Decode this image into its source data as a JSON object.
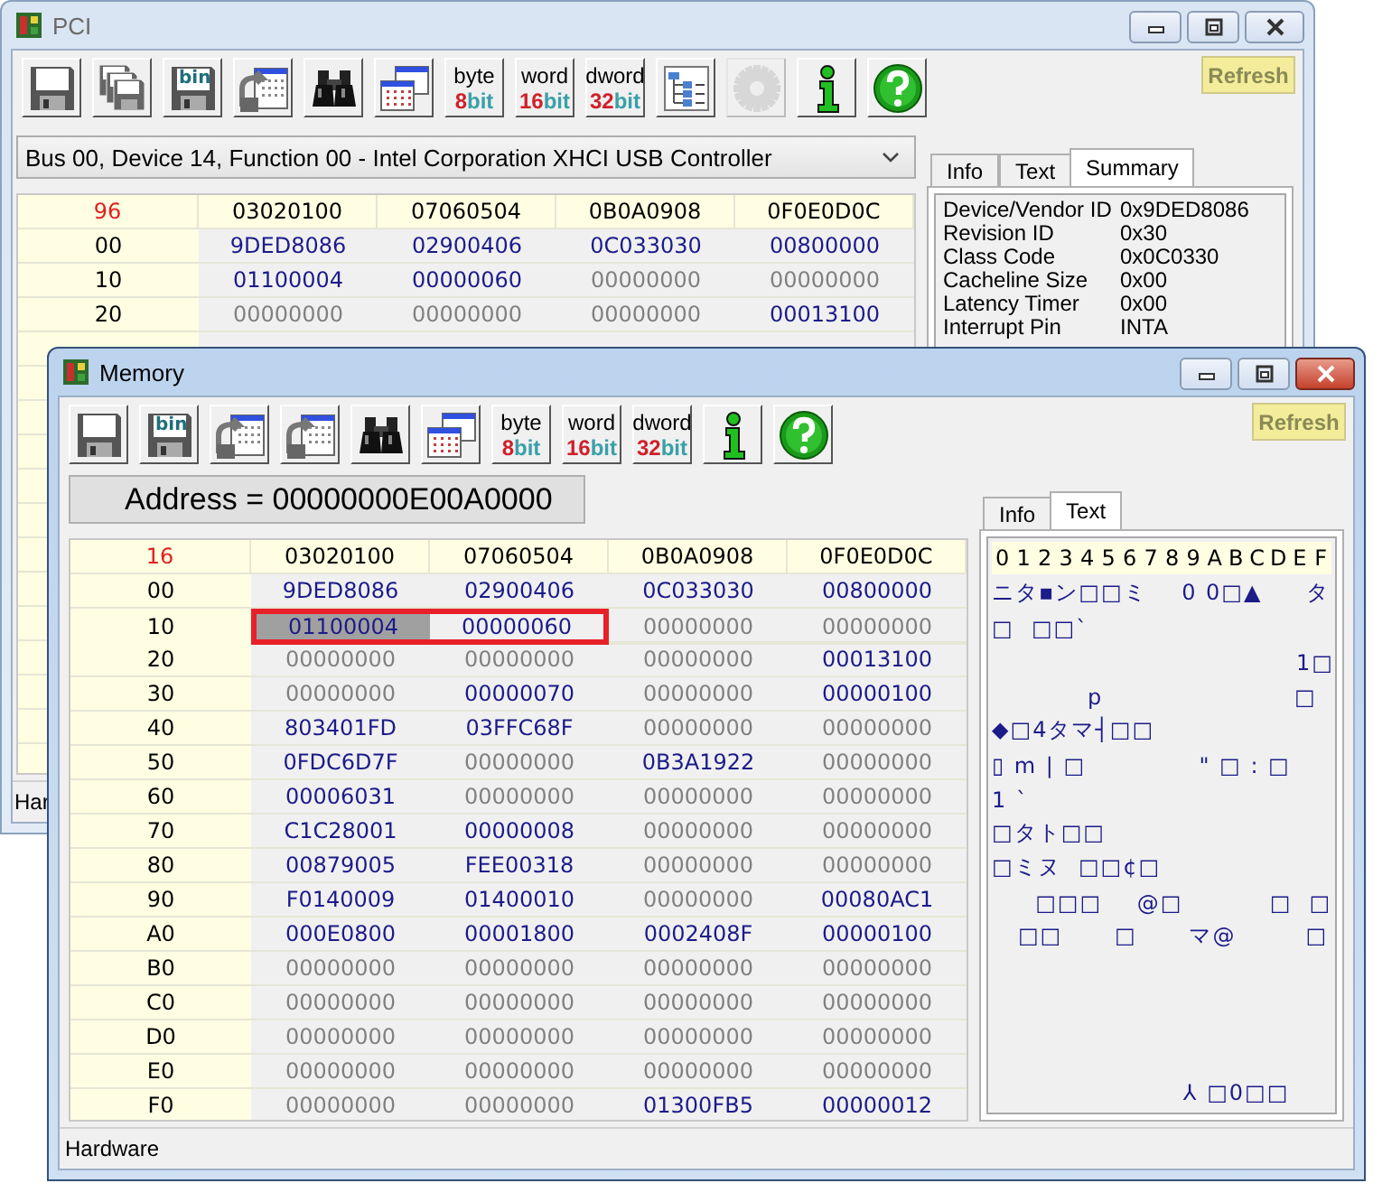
{
  "windows": [
    {
      "title": "PCI",
      "active": false,
      "toolbar": [
        {
          "kind": "floppy",
          "disabled": false
        },
        {
          "kind": "floppies",
          "disabled": false
        },
        {
          "kind": "bin",
          "label": "bin",
          "disabled": false
        },
        {
          "kind": "import",
          "disabled": false
        },
        {
          "kind": "binoculars",
          "disabled": false
        },
        {
          "kind": "windows",
          "disabled": false
        },
        {
          "kind": "width",
          "top": "byte",
          "num": "8",
          "unit": "bit",
          "disabled": false
        },
        {
          "kind": "width",
          "top": "word",
          "num": "16",
          "unit": "bit",
          "disabled": false
        },
        {
          "kind": "width",
          "top": "dword",
          "num": "32",
          "unit": "bit",
          "disabled": false
        },
        {
          "kind": "tree",
          "disabled": false
        },
        {
          "kind": "gear",
          "disabled": true
        },
        {
          "kind": "info",
          "disabled": false
        },
        {
          "kind": "help",
          "disabled": false
        }
      ],
      "refresh": "Refresh",
      "selector": {
        "kind": "dropdown",
        "text": "Bus 00, Device 14, Function 00 - Intel Corporation XHCI USB Controller"
      },
      "table": {
        "corner": "96",
        "columns": [
          "03020100",
          "07060504",
          "0B0A0908",
          "0F0E0D0C"
        ],
        "rows": [
          {
            "addr": "00",
            "marked": false,
            "cells": [
              {
                "v": "9DED8086",
                "dim": false,
                "selected": false
              },
              {
                "v": "02900406",
                "dim": false,
                "selected": false
              },
              {
                "v": "0C033030",
                "dim": false,
                "selected": false
              },
              {
                "v": "00800000",
                "dim": false,
                "selected": false
              }
            ]
          },
          {
            "addr": "10",
            "marked": false,
            "cells": [
              {
                "v": "01100004",
                "dim": false,
                "selected": false
              },
              {
                "v": "00000060",
                "dim": false,
                "selected": false
              },
              {
                "v": "00000000",
                "dim": true,
                "selected": false
              },
              {
                "v": "00000000",
                "dim": true,
                "selected": false
              }
            ]
          },
          {
            "addr": "20",
            "marked": false,
            "cells": [
              {
                "v": "00000000",
                "dim": true,
                "selected": false
              },
              {
                "v": "00000000",
                "dim": true,
                "selected": false
              },
              {
                "v": "00000000",
                "dim": true,
                "selected": false
              },
              {
                "v": "00013100",
                "dim": false,
                "selected": false
              }
            ]
          }
        ]
      },
      "tabs": [
        {
          "label": "Info",
          "selected": false
        },
        {
          "label": "Text",
          "selected": false
        },
        {
          "label": "Summary",
          "selected": true
        }
      ],
      "summary": [
        {
          "label": "Device/Vendor ID",
          "value": "0x9DED8086"
        },
        {
          "label": "Revision ID",
          "value": "0x30"
        },
        {
          "label": "Class Code",
          "value": "0x0C0330"
        },
        {
          "label": "Cacheline Size",
          "value": "0x00"
        },
        {
          "label": "Latency Timer",
          "value": "0x00"
        },
        {
          "label": "Interrupt Pin",
          "value": "INTA"
        }
      ],
      "status": "Har"
    },
    {
      "title": "Memory",
      "active": true,
      "toolbar": [
        {
          "kind": "floppy",
          "disabled": false
        },
        {
          "kind": "bin",
          "label": "bin",
          "disabled": false
        },
        {
          "kind": "import",
          "disabled": false
        },
        {
          "kind": "import",
          "disabled": false
        },
        {
          "kind": "binoculars",
          "disabled": false
        },
        {
          "kind": "windows",
          "disabled": false
        },
        {
          "kind": "width",
          "top": "byte",
          "num": "8",
          "unit": "bit",
          "disabled": false
        },
        {
          "kind": "width",
          "top": "word",
          "num": "16",
          "unit": "bit",
          "disabled": false
        },
        {
          "kind": "width",
          "top": "dword",
          "num": "32",
          "unit": "bit",
          "disabled": false
        },
        {
          "kind": "info",
          "disabled": false
        },
        {
          "kind": "help",
          "disabled": false
        }
      ],
      "refresh": "Refresh",
      "selector": {
        "kind": "address",
        "text": "Address = 00000000E00A0000"
      },
      "table": {
        "corner": "16",
        "columns": [
          "03020100",
          "07060504",
          "0B0A0908",
          "0F0E0D0C"
        ],
        "rows": [
          {
            "addr": "00",
            "marked": false,
            "cells": [
              {
                "v": "9DED8086",
                "dim": false,
                "selected": false
              },
              {
                "v": "02900406",
                "dim": false,
                "selected": false
              },
              {
                "v": "0C033030",
                "dim": false,
                "selected": false
              },
              {
                "v": "00800000",
                "dim": false,
                "selected": false
              }
            ]
          },
          {
            "addr": "10",
            "marked": true,
            "cells": [
              {
                "v": "01100004",
                "dim": false,
                "selected": true
              },
              {
                "v": "00000060",
                "dim": false,
                "selected": false
              },
              {
                "v": "00000000",
                "dim": true,
                "selected": false
              },
              {
                "v": "00000000",
                "dim": true,
                "selected": false
              }
            ]
          },
          {
            "addr": "20",
            "marked": false,
            "cells": [
              {
                "v": "00000000",
                "dim": true,
                "selected": false
              },
              {
                "v": "00000000",
                "dim": true,
                "selected": false
              },
              {
                "v": "00000000",
                "dim": true,
                "selected": false
              },
              {
                "v": "00013100",
                "dim": false,
                "selected": false
              }
            ]
          },
          {
            "addr": "30",
            "marked": false,
            "cells": [
              {
                "v": "00000000",
                "dim": true,
                "selected": false
              },
              {
                "v": "00000070",
                "dim": false,
                "selected": false
              },
              {
                "v": "00000000",
                "dim": true,
                "selected": false
              },
              {
                "v": "00000100",
                "dim": false,
                "selected": false
              }
            ]
          },
          {
            "addr": "40",
            "marked": false,
            "cells": [
              {
                "v": "803401FD",
                "dim": false,
                "selected": false
              },
              {
                "v": "03FFC68F",
                "dim": false,
                "selected": false
              },
              {
                "v": "00000000",
                "dim": true,
                "selected": false
              },
              {
                "v": "00000000",
                "dim": true,
                "selected": false
              }
            ]
          },
          {
            "addr": "50",
            "marked": false,
            "cells": [
              {
                "v": "0FDC6D7F",
                "dim": false,
                "selected": false
              },
              {
                "v": "00000000",
                "dim": true,
                "selected": false
              },
              {
                "v": "0B3A1922",
                "dim": false,
                "selected": false
              },
              {
                "v": "00000000",
                "dim": true,
                "selected": false
              }
            ]
          },
          {
            "addr": "60",
            "marked": false,
            "cells": [
              {
                "v": "00006031",
                "dim": false,
                "selected": false
              },
              {
                "v": "00000000",
                "dim": true,
                "selected": false
              },
              {
                "v": "00000000",
                "dim": true,
                "selected": false
              },
              {
                "v": "00000000",
                "dim": true,
                "selected": false
              }
            ]
          },
          {
            "addr": "70",
            "marked": false,
            "cells": [
              {
                "v": "C1C28001",
                "dim": false,
                "selected": false
              },
              {
                "v": "00000008",
                "dim": false,
                "selected": false
              },
              {
                "v": "00000000",
                "dim": true,
                "selected": false
              },
              {
                "v": "00000000",
                "dim": true,
                "selected": false
              }
            ]
          },
          {
            "addr": "80",
            "marked": false,
            "cells": [
              {
                "v": "00879005",
                "dim": false,
                "selected": false
              },
              {
                "v": "FEE00318",
                "dim": false,
                "selected": false
              },
              {
                "v": "00000000",
                "dim": true,
                "selected": false
              },
              {
                "v": "00000000",
                "dim": true,
                "selected": false
              }
            ]
          },
          {
            "addr": "90",
            "marked": false,
            "cells": [
              {
                "v": "F0140009",
                "dim": false,
                "selected": false
              },
              {
                "v": "01400010",
                "dim": false,
                "selected": false
              },
              {
                "v": "00000000",
                "dim": true,
                "selected": false
              },
              {
                "v": "00080AC1",
                "dim": false,
                "selected": false
              }
            ]
          },
          {
            "addr": "A0",
            "marked": false,
            "cells": [
              {
                "v": "000E0800",
                "dim": false,
                "selected": false
              },
              {
                "v": "00001800",
                "dim": false,
                "selected": false
              },
              {
                "v": "0002408F",
                "dim": false,
                "selected": false
              },
              {
                "v": "00000100",
                "dim": false,
                "selected": false
              }
            ]
          },
          {
            "addr": "B0",
            "marked": false,
            "cells": [
              {
                "v": "00000000",
                "dim": true,
                "selected": false
              },
              {
                "v": "00000000",
                "dim": true,
                "selected": false
              },
              {
                "v": "00000000",
                "dim": true,
                "selected": false
              },
              {
                "v": "00000000",
                "dim": true,
                "selected": false
              }
            ]
          },
          {
            "addr": "C0",
            "marked": false,
            "cells": [
              {
                "v": "00000000",
                "dim": true,
                "selected": false
              },
              {
                "v": "00000000",
                "dim": true,
                "selected": false
              },
              {
                "v": "00000000",
                "dim": true,
                "selected": false
              },
              {
                "v": "00000000",
                "dim": true,
                "selected": false
              }
            ]
          },
          {
            "addr": "D0",
            "marked": false,
            "cells": [
              {
                "v": "00000000",
                "dim": true,
                "selected": false
              },
              {
                "v": "00000000",
                "dim": true,
                "selected": false
              },
              {
                "v": "00000000",
                "dim": true,
                "selected": false
              },
              {
                "v": "00000000",
                "dim": true,
                "selected": false
              }
            ]
          },
          {
            "addr": "E0",
            "marked": false,
            "cells": [
              {
                "v": "00000000",
                "dim": true,
                "selected": false
              },
              {
                "v": "00000000",
                "dim": true,
                "selected": false
              },
              {
                "v": "00000000",
                "dim": true,
                "selected": false
              },
              {
                "v": "00000000",
                "dim": true,
                "selected": false
              }
            ]
          },
          {
            "addr": "F0",
            "marked": false,
            "cells": [
              {
                "v": "00000000",
                "dim": true,
                "selected": false
              },
              {
                "v": "00000000",
                "dim": true,
                "selected": false
              },
              {
                "v": "01300FB5",
                "dim": false,
                "selected": false
              },
              {
                "v": "00000012",
                "dim": false,
                "selected": false
              }
            ]
          }
        ]
      },
      "tabs": [
        {
          "label": "Info",
          "selected": false
        },
        {
          "label": "Text",
          "selected": true
        }
      ],
      "text_panel": {
        "header": [
          "0",
          "1",
          "2",
          "3",
          "4",
          "5",
          "6",
          "7",
          "8",
          "9",
          "A",
          "B",
          "C",
          "D",
          "E",
          "F"
        ],
        "lines": [
          "ニタ▪ン□□ミ    0 0□▲     タ",
          "□  □□`",
          "                                   1□",
          "           p                      □",
          "◆□4タマ┤□□",
          "▯ m | □             \" □ : □",
          "1 `",
          "□タト□□",
          "□ミヌ  □□¢□",
          "     □□□    @□          □  □",
          "   □□      □      マ@        □"
        ],
        "last_line": "                      ⅄ □0□□"
      },
      "status": "Hardware"
    }
  ]
}
